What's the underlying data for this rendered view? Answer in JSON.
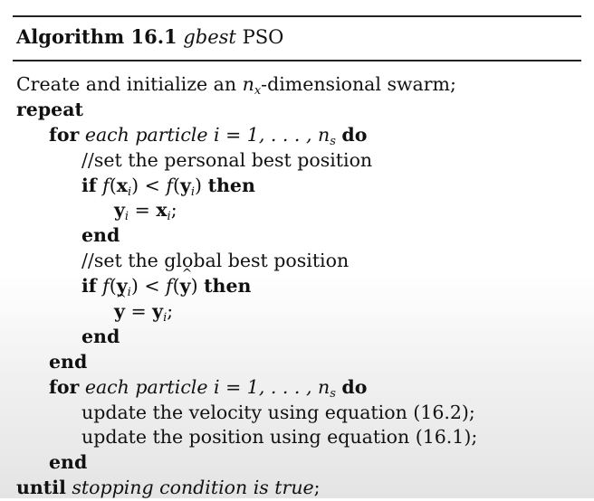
{
  "header": {
    "label": "Algorithm 16.1",
    "name": "gbest",
    "suffix": "PSO"
  },
  "lines": {
    "l1_a": "Create and initialize an ",
    "l1_sub": "x",
    "l1_b": "-dimensional swarm;",
    "repeat": "repeat",
    "for": "for",
    "each_particle": "each particle",
    "i_range": " i = 1, . . . , n",
    "s_sub": "s",
    "do": "do",
    "comment_personal": "//set the personal best position",
    "if": "if",
    "then": "then",
    "y_assign_x": "y",
    "end": "end",
    "comment_global": "//set the global best position",
    "update_velocity": "update the velocity using equation (16.2);",
    "update_position": "update the position using equation (16.1);",
    "until": "until",
    "stopping": "stopping condition is true",
    "semicolon": ";"
  }
}
